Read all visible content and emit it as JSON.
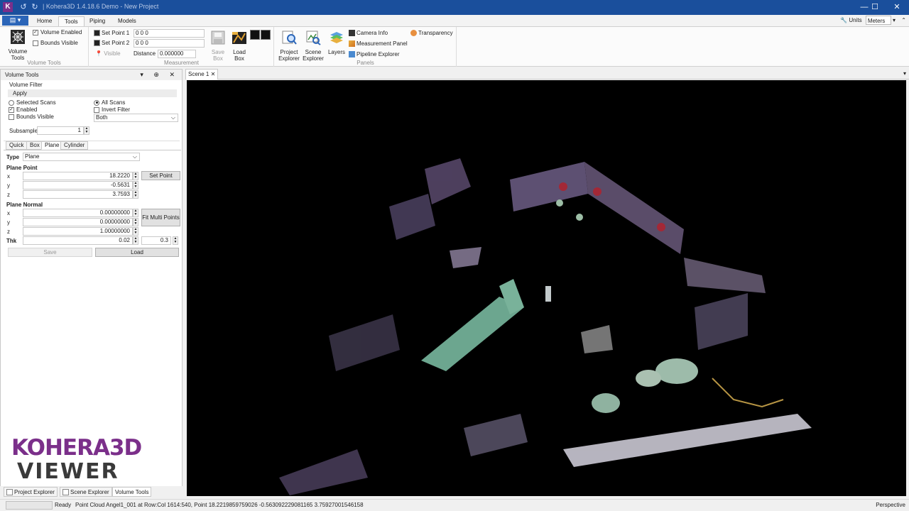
{
  "titlebar": {
    "app_letter": "K",
    "title": "| Kohera3D 1.4.18.6 Demo - New Project",
    "minimize": "—",
    "maximize": "☐",
    "close": "✕"
  },
  "ribbon_tabs": [
    "Home",
    "Tools",
    "Piping",
    "Models"
  ],
  "units": {
    "label": "Units",
    "value": "Meters"
  },
  "ribbon": {
    "volume_tools_btn": "Volume\nTools",
    "volume_enabled": "Volume Enabled",
    "bounds_visible": "Bounds Visible",
    "group_volume_tools": "Volume Tools",
    "set_point_1": "Set Point 1",
    "set_point_1_value": "0 0 0",
    "set_point_2": "Set Point 2",
    "set_point_2_value": "0 0 0",
    "visible": "Visible",
    "distance_label": "Distance",
    "distance_value": "0.000000",
    "save_box": "Save\nBox",
    "load_box": "Load\nBox",
    "group_measurement": "Measurement",
    "project_explorer": "Project\nExplorer",
    "scene_explorer": "Scene\nExplorer",
    "layers": "Layers",
    "camera_info": "Camera Info",
    "measurement_panel": "Measurement Panel",
    "pipeline_explorer": "Pipeline Explorer",
    "transparency": "Transparency",
    "group_panels": "Panels"
  },
  "panel": {
    "title": "Volume Tools",
    "header_buttons": "▾ ⊕ ✕",
    "volume_filter": "Volume Filter",
    "apply": "Apply",
    "selected_scans": "Selected Scans",
    "all_scans": "All Scans",
    "enabled": "Enabled",
    "invert_filter": "Invert Filter",
    "bounds_visible": "Bounds Visible",
    "mode_value": "Both",
    "subsample_label": "Subsample",
    "subsample_value": "1",
    "tabs": [
      "Quick",
      "Box",
      "Plane",
      "Cylinder"
    ],
    "type_label": "Type",
    "type_value": "Plane",
    "plane_point": "Plane Point",
    "pp_x": "18.2220",
    "pp_y": "-0.5631",
    "pp_z": "3.7593",
    "set_point": "Set Point",
    "plane_normal": "Plane Normal",
    "pn_x": "0.00000000",
    "pn_y": "0.00000000",
    "pn_z": "1.00000000",
    "fit_multi": "Fit Multi Points",
    "thk_label": "Thk",
    "thk_value": "0.02",
    "thk_step": "0.3",
    "save": "Save",
    "load": "Load",
    "x": "x",
    "y": "y",
    "z": "z"
  },
  "logo": {
    "line1": "KOHERA3D",
    "line2": "VIEWER"
  },
  "bottom_tabs": [
    "Project Explorer",
    "Scene Explorer",
    "Volume Tools"
  ],
  "scene_tab": "Scene 1",
  "status": {
    "ready": "Ready",
    "message": "Point Cloud Angel1_001 at Row:Col 1614:540, Point 18.2219859759026 -0.563092229081165 3.75927001546158",
    "projection": "Perspective"
  },
  "colors": {
    "titlebar": "#1a4f9c",
    "accent_purple": "#7b2f8a",
    "viewport": "#000000"
  }
}
